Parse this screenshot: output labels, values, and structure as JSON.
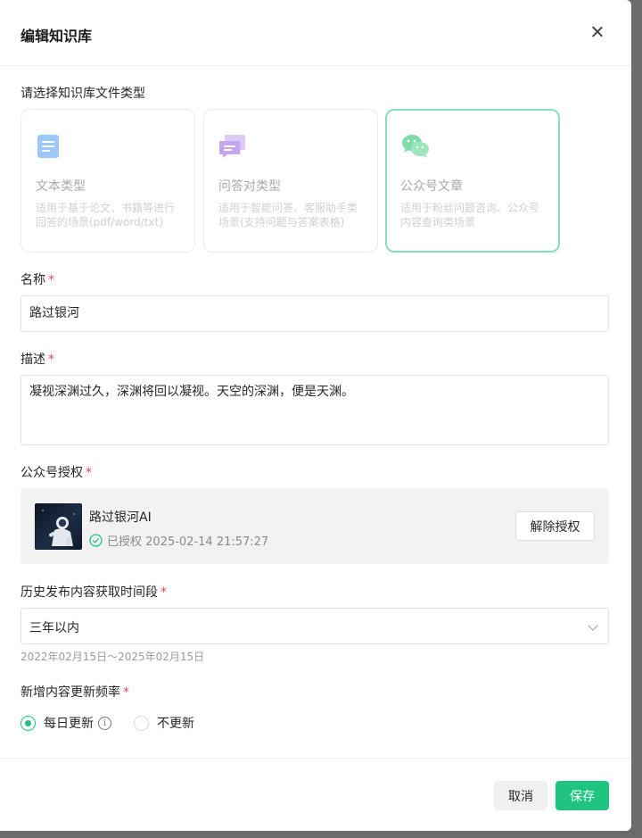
{
  "modal": {
    "title": "编辑知识库",
    "close_icon": "close-icon"
  },
  "file_type": {
    "label": "请选择知识库文件类型",
    "cards": [
      {
        "name": "文本类型",
        "desc": "适用于基于论文、书籍等进行回答的场景(pdf/word/txt)",
        "icon": "document-icon",
        "selected": false
      },
      {
        "name": "问答对类型",
        "desc": "适用于智能问答、客服助手类场景(支持问题与答案表格)",
        "icon": "chat-bubbles-icon",
        "selected": false
      },
      {
        "name": "公众号文章",
        "desc": "适用于粉丝问题咨询、公众号内容查询类场景",
        "icon": "wechat-icon",
        "selected": true
      }
    ]
  },
  "name_field": {
    "label": "名称",
    "required": "*",
    "value": "路过银河"
  },
  "desc_field": {
    "label": "描述",
    "required": "*",
    "value": "凝视深渊过久，深渊将回以凝视。天空的深渊，便是天渊。"
  },
  "auth": {
    "label": "公众号授权",
    "required": "*",
    "account_name": "路过银河AI",
    "status": "已授权 2025-02-14 21:57:27",
    "revoke_label": "解除授权"
  },
  "history": {
    "label": "历史发布内容获取时间段",
    "required": "*",
    "selected": "三年以内",
    "range": "2022年02月15日～2025年02月15日"
  },
  "frequency": {
    "label": "新增内容更新频率",
    "required": "*",
    "options": [
      {
        "label": "每日更新",
        "checked": true
      },
      {
        "label": "不更新",
        "checked": false
      }
    ]
  },
  "footer": {
    "cancel_label": "取消",
    "save_label": "保存"
  },
  "colors": {
    "accent": "#1ec47f",
    "selected_border": "#86e0b8",
    "required": "#e5484d"
  }
}
